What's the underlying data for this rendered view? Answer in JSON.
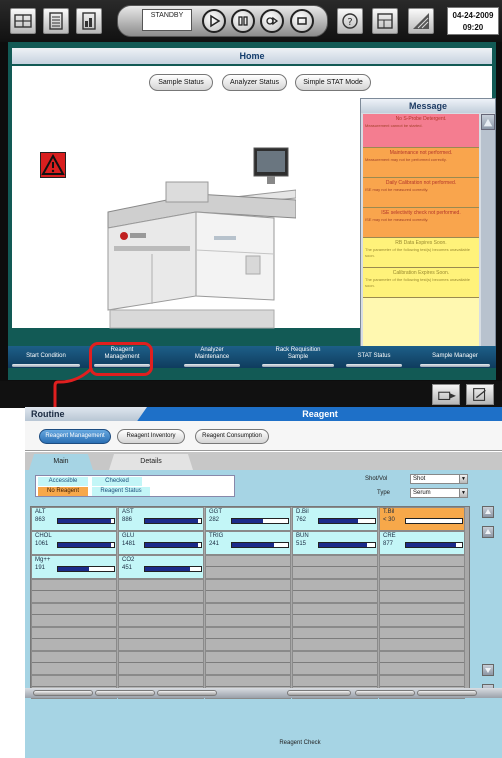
{
  "top_screen": {
    "status_text": "STANDBY",
    "date": "04-24-2009",
    "time": "09:20",
    "home_title": "Home",
    "home_buttons": [
      "Sample Status",
      "Analyzer Status",
      "Simple STAT Mode"
    ],
    "message_title": "Message",
    "messages": [
      {
        "line1": "No S-Probe Detergent.",
        "line2": "Measurement cannot be started.",
        "color": "#f47d90"
      },
      {
        "line1": "Maintenance not performed.",
        "line2": "Measurement may not be performed correctly.",
        "color": "#f9a54d"
      },
      {
        "line1": "Daily Calibration not performed.",
        "line2": "ISE may not be measured correctly.",
        "color": "#f9a54d"
      },
      {
        "line1": "ISE selectivity check not performed.",
        "line2": "ISE may not be measured correctly.",
        "color": "#f9a54d"
      },
      {
        "line1": "RB Data Expires Soon.",
        "line2": "The parameter of the following test(s) becomes unavailable soon.",
        "color": "#fff27a"
      },
      {
        "line1": "Calibration Expires Soon.",
        "line2": "The parameter of the following test(s) becomes unavailable soon.",
        "color": "#fff27a"
      }
    ],
    "nav_tabs": [
      {
        "line1": "Start Condition",
        "line2": ""
      },
      {
        "line1": "Reagent",
        "line2": "Management"
      },
      {
        "line1": "Analyzer",
        "line2": "Maintenance"
      },
      {
        "line1": "Rack Requisition",
        "line2": "Sample"
      },
      {
        "line1": "STAT Status",
        "line2": ""
      },
      {
        "line1": "Sample Manager",
        "line2": ""
      }
    ],
    "colors": {
      "panel": "#125a55",
      "alarm": "#d91f1f",
      "highlight": "#e01f1f"
    }
  },
  "bottom_screen": {
    "routine_tab": "Routine",
    "title": "Reagent",
    "buttons": [
      "Reagent Management",
      "Reagent Inventory",
      "Reagent Consumption"
    ],
    "sub_tabs": [
      "Main",
      "Details"
    ],
    "legend": {
      "accessible": "Accessible",
      "checked": "Checked",
      "no_reagent": "No Reagent",
      "reagent_status": "Reagent Status"
    },
    "shot_vol_label": "Shot/Vol",
    "shot_vol_value": "Shot",
    "type_label": "Type",
    "type_value": "Serum",
    "reagents": [
      {
        "name": "ALT",
        "value": "863",
        "fill": 0.95,
        "status": "accessible"
      },
      {
        "name": "AST",
        "value": "886",
        "fill": 0.95,
        "status": "accessible"
      },
      {
        "name": "GGT",
        "value": "282",
        "fill": 0.55,
        "status": "accessible"
      },
      {
        "name": "D.Bil",
        "value": "762",
        "fill": 0.7,
        "status": "accessible"
      },
      {
        "name": "T.Bil",
        "value": "< 30",
        "fill": 0.0,
        "status": "no_reagent"
      },
      {
        "name": "CHOL",
        "value": "1061",
        "fill": 0.95,
        "status": "accessible"
      },
      {
        "name": "GLU",
        "value": "1481",
        "fill": 0.95,
        "status": "accessible"
      },
      {
        "name": "TRIG",
        "value": "241",
        "fill": 0.75,
        "status": "accessible"
      },
      {
        "name": "BUN",
        "value": "515",
        "fill": 0.85,
        "status": "accessible"
      },
      {
        "name": "CRE",
        "value": "877",
        "fill": 0.9,
        "status": "accessible"
      },
      {
        "name": "Mg++",
        "value": "191",
        "fill": 0.55,
        "status": "accessible"
      },
      {
        "name": "CO2",
        "value": "451",
        "fill": 0.8,
        "status": "accessible"
      }
    ],
    "reagent_check": "Reagent Check",
    "colors": {
      "accessible": "#c3f6f7",
      "no_reagent": "#f7a84a",
      "empty": "#b3b3b3",
      "bar": "#1c2a8a"
    }
  }
}
